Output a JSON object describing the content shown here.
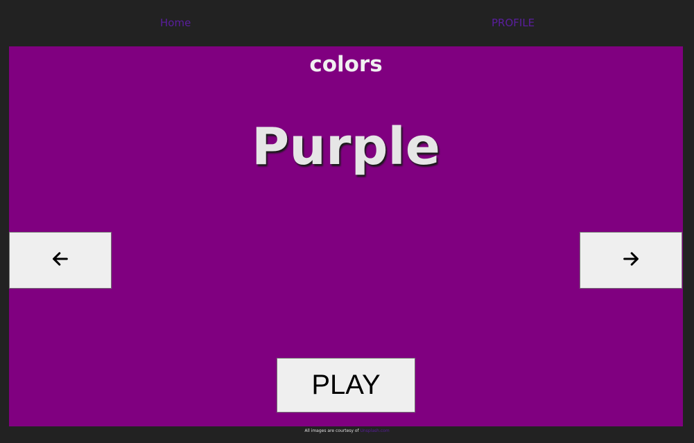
{
  "nav": {
    "home_label": "Home",
    "profile_label": "PROFILE"
  },
  "stage": {
    "background_color": "#800080",
    "category": "colors",
    "word": "Purple",
    "prev_icon": "arrow-left-icon",
    "next_icon": "arrow-right-icon",
    "play_label": "PLAY"
  },
  "footer": {
    "text": "All images are courtesy of",
    "link_text": "Unsplash.com"
  },
  "colors": {
    "page_background": "#222222",
    "link": "#5a1e9e",
    "button_background": "#efefef"
  }
}
